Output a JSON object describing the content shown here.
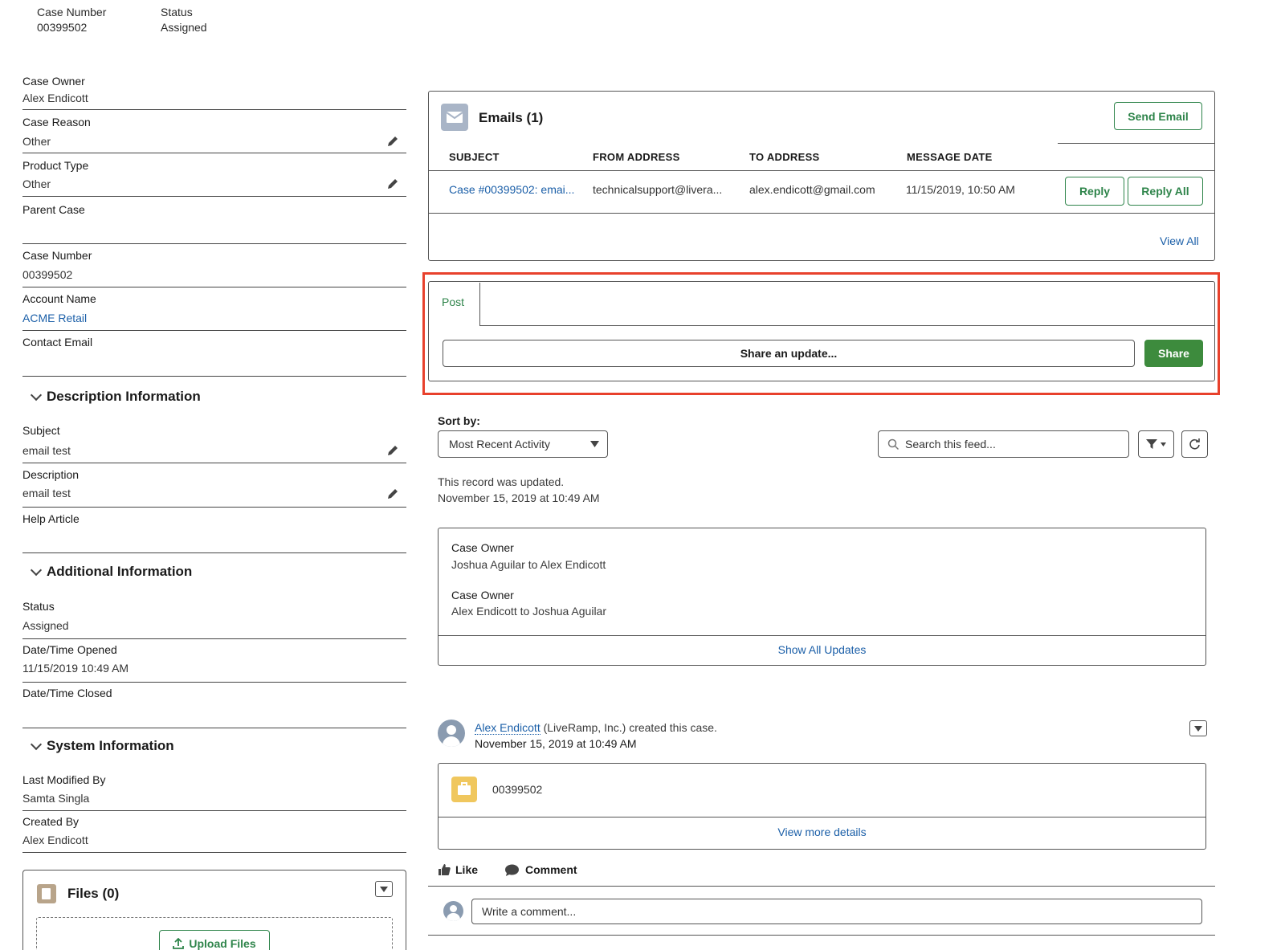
{
  "header": {
    "case_number_label": "Case Number",
    "case_number_value": "00399502",
    "status_label": "Status",
    "status_value": "Assigned"
  },
  "details": {
    "case_owner_label": "Case Owner",
    "case_owner_value": "Alex Endicott",
    "case_reason_label": "Case Reason",
    "case_reason_value": "Other",
    "product_type_label": "Product Type",
    "product_type_value": "Other",
    "parent_case_label": "Parent Case",
    "case_number_label": "Case Number",
    "case_number_value": "00399502",
    "account_name_label": "Account Name",
    "account_name_value": "ACME Retail",
    "contact_email_label": "Contact Email"
  },
  "description_section": {
    "title": "Description Information",
    "subject_label": "Subject",
    "subject_value": "email test",
    "description_label": "Description",
    "description_value": "email test",
    "help_article_label": "Help Article"
  },
  "additional_section": {
    "title": "Additional Information",
    "status_label": "Status",
    "status_value": "Assigned",
    "opened_label": "Date/Time Opened",
    "opened_value": "11/15/2019 10:49 AM",
    "closed_label": "Date/Time Closed"
  },
  "system_section": {
    "title": "System Information",
    "modified_label": "Last Modified By",
    "modified_value": "Samta Singla",
    "created_label": "Created By",
    "created_value": "Alex Endicott"
  },
  "files": {
    "title": "Files (0)",
    "upload_label": "Upload Files"
  },
  "emails": {
    "title": "Emails (1)",
    "send_label": "Send Email",
    "columns": [
      "SUBJECT",
      "FROM ADDRESS",
      "TO ADDRESS",
      "MESSAGE DATE"
    ],
    "row": {
      "subject": "Case #00399502: emai...",
      "from": "technicalsupport@livera...",
      "to": "alex.endicott@gmail.com",
      "date": "11/15/2019, 10:50 AM"
    },
    "reply_label": "Reply",
    "reply_all_label": "Reply All",
    "view_all": "View All"
  },
  "publisher": {
    "post_tab": "Post",
    "share_placeholder": "Share an update...",
    "share_label": "Share",
    "highlight_color": "#e8412c"
  },
  "feed": {
    "sort_label": "Sort by:",
    "sort_value": "Most Recent Activity",
    "search_placeholder": "Search this feed...",
    "update_text": "This record was updated.",
    "update_time": "November 15, 2019 at 10:49 AM",
    "changes": [
      {
        "field": "Case Owner",
        "change": "Joshua Aguilar to Alex Endicott"
      },
      {
        "field": "Case Owner",
        "change": "Alex Endicott to Joshua Aguilar"
      }
    ],
    "show_all": "Show All Updates",
    "post_author": "Alex Endicott",
    "post_text": "(LiveRamp, Inc.) created this case.",
    "post_time": "November 15, 2019 at 10:49 AM",
    "case_card_number": "00399502",
    "view_more": "View more details",
    "like_label": "Like",
    "comment_label": "Comment",
    "comment_placeholder": "Write a comment..."
  }
}
